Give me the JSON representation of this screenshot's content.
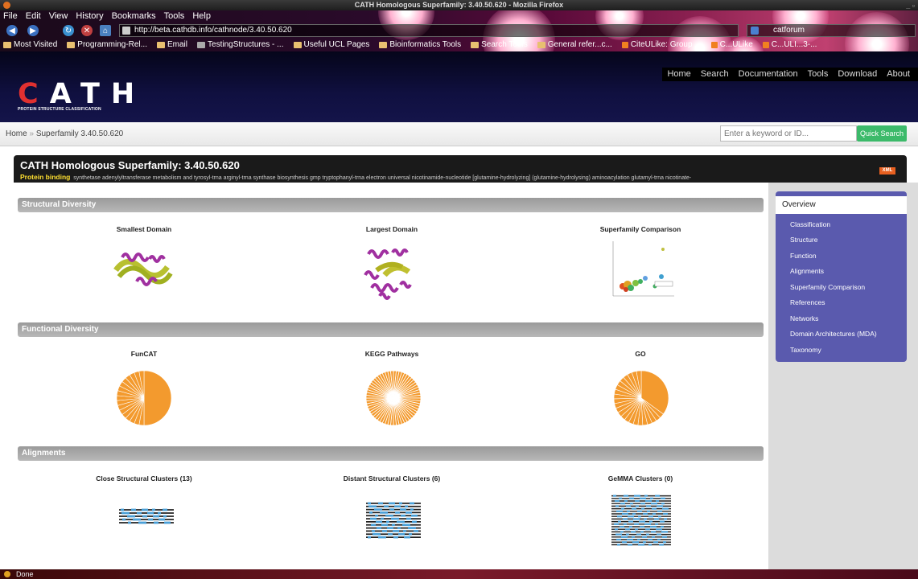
{
  "browser": {
    "window_title": "CATH Homologous Superfamily: 3.40.50.620 - Mozilla Firefox",
    "menu": [
      "File",
      "Edit",
      "View",
      "History",
      "Bookmarks",
      "Tools",
      "Help"
    ],
    "url": "http://beta.cathdb.info/cathnode/3.40.50.620",
    "search_value": "catforum",
    "bookmarks": [
      "Most Visited",
      "Programming-Rel...",
      "Email",
      "TestingStructures - ...",
      "Useful UCL Pages",
      "Bioinformatics Tools",
      "Search Tools",
      "General refer...c...",
      "CiteULike: Group ...",
      "C...ULike",
      "C...ULI...3-..."
    ],
    "status": "Done"
  },
  "site": {
    "logo": "CATH",
    "tagline": "PROTEIN STRUCTURE CLASSIFICATION",
    "nav": [
      "Home",
      "Search",
      "Documentation",
      "Tools",
      "Download",
      "About"
    ]
  },
  "breadcrumb": {
    "home": "Home",
    "sep": "»",
    "current": "Superfamily 3.40.50.620"
  },
  "quick_search": {
    "placeholder": "Enter a keyword or ID...",
    "button": "Quick Search"
  },
  "superfamily": {
    "title": "CATH Homologous Superfamily: 3.40.50.620",
    "highlight": "Protein binding",
    "keywords": "synthetase  adenylyltransferase  metabolism  and  tyrosyl-trna  arginyl-trna  synthase  biosynthesis  gmp  tryptophanyl-trna  electron  universal  nicotinamide-nucleotide  [glutamine-hydrolyzing]  (glutamine-hydrolysing)  aminoacylation  glutamyl-trna  nicotinate-",
    "xml": "XML"
  },
  "sidebar": {
    "active": "Overview",
    "items": [
      "Classification",
      "Structure",
      "Function",
      "Alignments",
      "Superfamily Comparison",
      "References",
      "Networks",
      "Domain Architectures (MDA)",
      "Taxonomy"
    ]
  },
  "sections": {
    "structural": {
      "title": "Structural Diversity",
      "cols": [
        "Smallest Domain",
        "Largest Domain",
        "Superfamily Comparison"
      ]
    },
    "functional": {
      "title": "Functional Diversity",
      "cols": [
        "FunCAT",
        "KEGG Pathways",
        "GO"
      ]
    },
    "alignments": {
      "title": "Alignments",
      "cols": [
        "Close Structural Clusters (13)",
        "Distant Structural Clusters (6)",
        "GeMMA Clusters (0)"
      ]
    }
  },
  "colors": {
    "pie_orange": "#f39a2e",
    "sidebar_purple": "#5a5aae",
    "quick_search_green": "#3cba6a",
    "highlight_yellow": "#ffe030"
  }
}
